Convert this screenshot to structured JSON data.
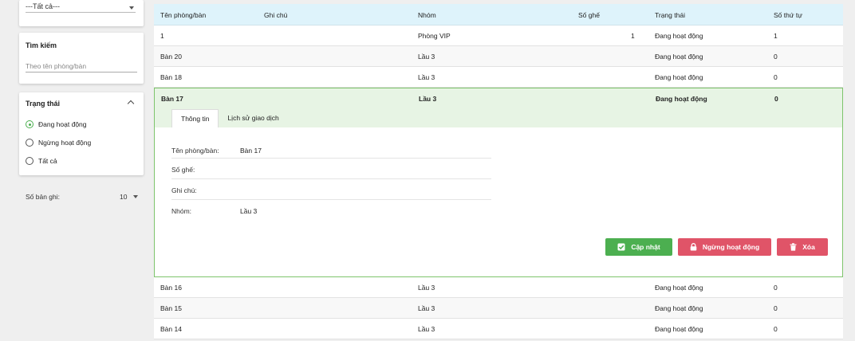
{
  "sidebar": {
    "filter_select": {
      "value": "---Tất cả---"
    },
    "search": {
      "title": "Tìm kiếm",
      "placeholder": "Theo tên phòng/bàn"
    },
    "status": {
      "title": "Trạng thái",
      "options": [
        {
          "label": "Đang hoạt động",
          "selected": true
        },
        {
          "label": "Ngừng hoạt động",
          "selected": false
        },
        {
          "label": "Tất cả",
          "selected": false
        }
      ]
    },
    "records": {
      "label": "Số bản ghi:",
      "value": "10"
    }
  },
  "table": {
    "headers": [
      "Tên phòng/bàn",
      "Ghi chú",
      "Nhóm",
      "Số ghế",
      "Trạng thái",
      "Số thứ tự"
    ],
    "rows_before": [
      {
        "name": "1",
        "note": "",
        "group": "Phòng VIP",
        "seats": "1",
        "status": "Đang hoạt động",
        "order": "1"
      },
      {
        "name": "Bàn 20",
        "note": "",
        "group": "Lầu 3",
        "seats": "",
        "status": "Đang hoạt động",
        "order": "0"
      },
      {
        "name": "Bàn 18",
        "note": "",
        "group": "Lầu 3",
        "seats": "",
        "status": "Đang hoạt động",
        "order": "0"
      }
    ],
    "expanded": {
      "name": "Bàn 17",
      "group": "Lầu 3",
      "status": "Đang hoạt động",
      "order": "0",
      "tabs": [
        "Thông tin",
        "Lịch sử giao dịch"
      ],
      "details": [
        {
          "label": "Tên phòng/bàn:",
          "value": "Bàn 17"
        },
        {
          "label": "Số ghế:",
          "value": ""
        },
        {
          "label": "Ghi chú:",
          "value": ""
        },
        {
          "label": "Nhóm:",
          "value": "Lầu 3"
        }
      ],
      "buttons": {
        "update": "Cập nhật",
        "stop": "Ngừng hoạt động",
        "delete": "Xóa"
      }
    },
    "rows_after": [
      {
        "name": "Bàn 16",
        "note": "",
        "group": "Lầu 3",
        "seats": "",
        "status": "Đang hoạt động",
        "order": "0"
      },
      {
        "name": "Bàn 15",
        "note": "",
        "group": "Lầu 3",
        "seats": "",
        "status": "Đang hoạt động",
        "order": "0"
      },
      {
        "name": "Bàn 14",
        "note": "",
        "group": "Lầu 3",
        "seats": "",
        "status": "Đang hoạt động",
        "order": "0"
      }
    ]
  },
  "colors": {
    "accent_green": "#4caf50",
    "danger": "#e05468",
    "header_bg": "#def3fb",
    "expanded_bg": "#e7f4e4"
  }
}
